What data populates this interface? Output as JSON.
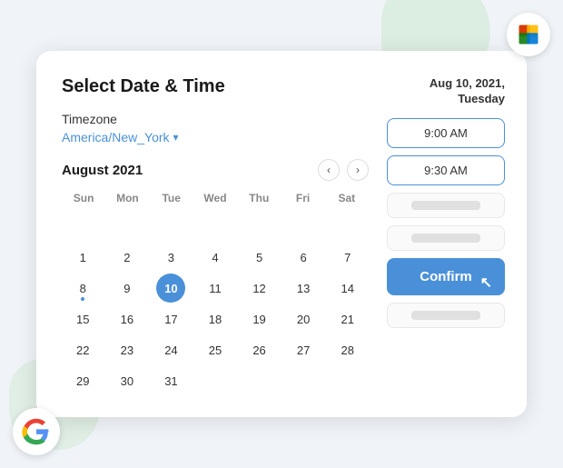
{
  "app": {
    "title": "Select Date & Time"
  },
  "timezone": {
    "label": "Timezone",
    "value": "America/New_York"
  },
  "calendar": {
    "month_year": "August 2021",
    "day_headers": [
      "Sun",
      "Mon",
      "Tue",
      "Wed",
      "Thu",
      "Fri",
      "Sat"
    ],
    "weeks": [
      [
        "",
        "",
        "",
        "",
        "",
        "",
        ""
      ],
      [
        "1",
        "2",
        "3",
        "4",
        "5",
        "6",
        "7"
      ],
      [
        "8",
        "9",
        "10",
        "11",
        "12",
        "13",
        "14"
      ],
      [
        "15",
        "16",
        "17",
        "18",
        "19",
        "20",
        "21"
      ],
      [
        "22",
        "23",
        "24",
        "25",
        "26",
        "27",
        "28"
      ],
      [
        "29",
        "30",
        "31",
        "",
        "",
        "",
        ""
      ]
    ],
    "selected_day": "10",
    "dot_days": [
      "8"
    ]
  },
  "right_panel": {
    "date_header": "Aug 10, 2021, Tuesday",
    "time_slots": [
      {
        "label": "9:00 AM",
        "type": "active"
      },
      {
        "label": "9:30 AM",
        "type": "active"
      },
      {
        "label": "",
        "type": "placeholder"
      },
      {
        "label": "",
        "type": "placeholder"
      },
      {
        "label": "",
        "type": "placeholder"
      },
      {
        "label": "",
        "type": "placeholder"
      }
    ],
    "confirm_label": "Confirm"
  },
  "icons": {
    "prev_arrow": "‹",
    "next_arrow": "›",
    "chevron_down": "▾"
  }
}
